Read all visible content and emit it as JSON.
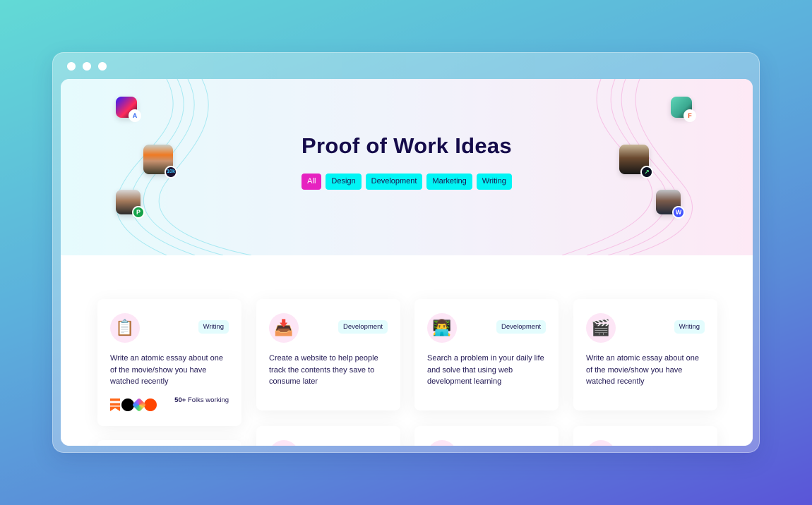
{
  "window": {
    "controls": [
      "close",
      "minimize",
      "maximize"
    ]
  },
  "hero": {
    "title": "Proof of Work Ideas",
    "filters": [
      {
        "label": "All",
        "active": true
      },
      {
        "label": "Design",
        "active": false
      },
      {
        "label": "Development",
        "active": false
      },
      {
        "label": "Marketing",
        "active": false
      },
      {
        "label": "Writing",
        "active": false
      }
    ],
    "avatars_left": [
      {
        "badge": "A",
        "badge_color": "#ffffff",
        "badge_text_color": "#3a6df0"
      },
      {
        "badge": "10k",
        "badge_color": "#1a1230",
        "badge_text_color": "#3fc6ff"
      },
      {
        "badge": "P",
        "badge_color": "#16a34a",
        "badge_text_color": "#ffffff"
      }
    ],
    "avatars_right": [
      {
        "badge": "F",
        "badge_color": "#ffffff",
        "badge_text_color": "#f24e1e"
      },
      {
        "badge": "↗",
        "badge_color": "#0b1020",
        "badge_text_color": "#5ef08a"
      },
      {
        "badge": "W",
        "badge_color": "#4353ff",
        "badge_text_color": "#ffffff"
      }
    ]
  },
  "cards": [
    {
      "icon": "📋",
      "icon_name": "clipboard-icon",
      "tag": "Writing",
      "description": "Write an atomic essay about one of the movie/show you have watched recently",
      "folks_count": "50+",
      "folks_label": "Folks working",
      "logos": [
        "substack-icon",
        "medium-icon",
        "hashnode-icon",
        "reddit-icon"
      ]
    },
    {
      "icon": "📥",
      "icon_name": "inbox-tray-icon",
      "tag": "Development",
      "description": "Create a website to help people track the contents they save to consume later"
    },
    {
      "icon": "👨‍💻",
      "icon_name": "technologist-icon",
      "tag": "Development",
      "description": "Search a problem in your daily life and solve that using web development learning"
    },
    {
      "icon": "🎬",
      "icon_name": "clapper-board-icon",
      "tag": "Writing",
      "description": "Write an atomic essay about one of the movie/show you have watched recently"
    }
  ]
}
